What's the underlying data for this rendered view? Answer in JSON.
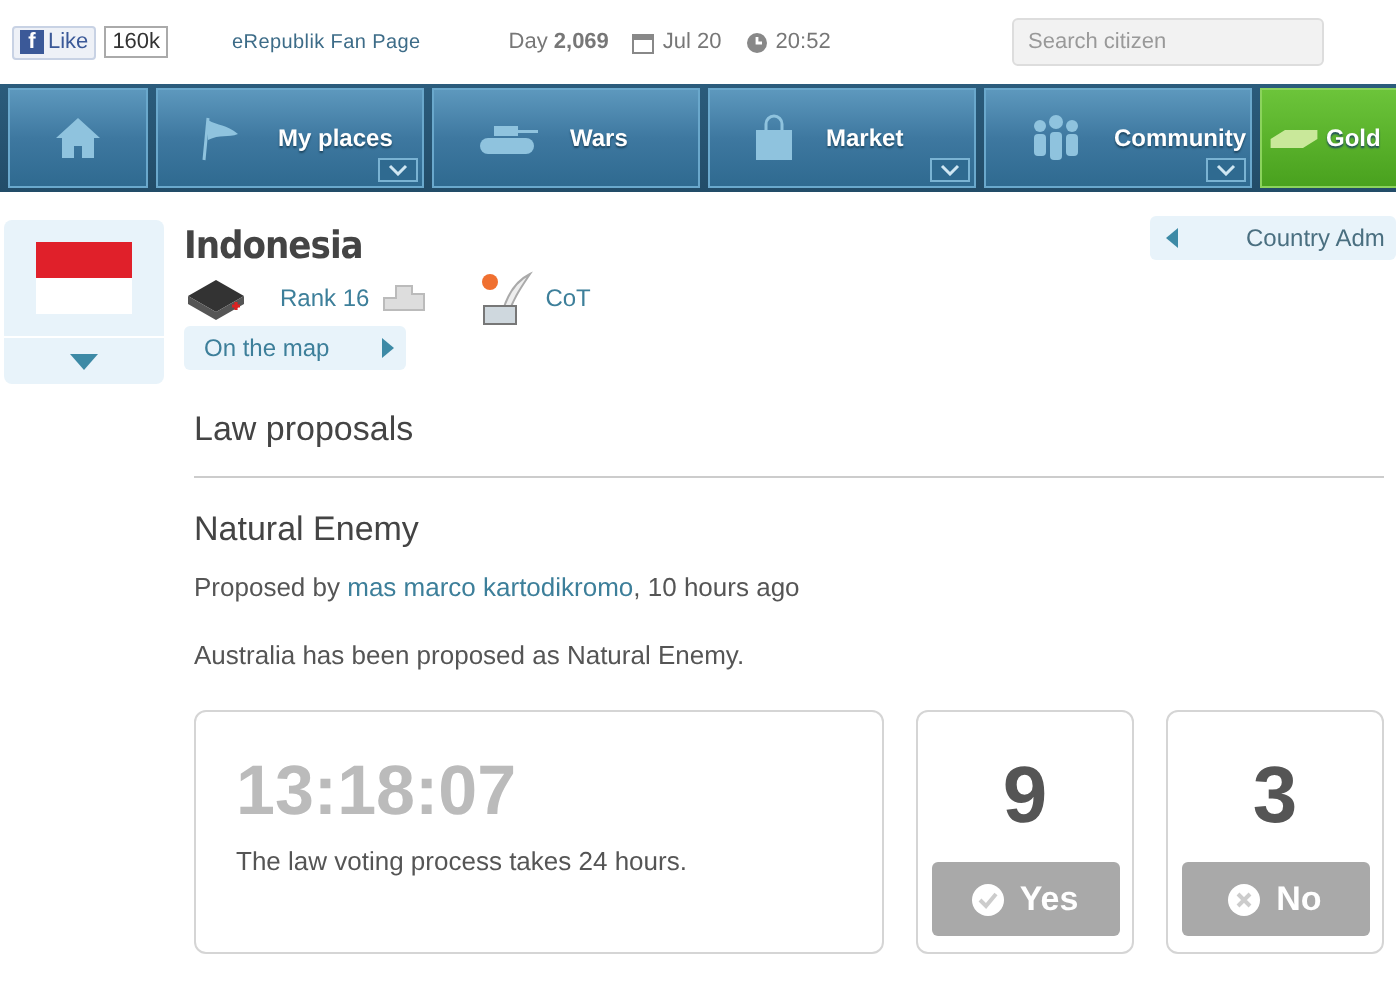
{
  "top_bar": {
    "like_icon": "f",
    "like_button": "Like",
    "like_count": "160k",
    "fan_page_link": "eRepublik Fan Page",
    "day": "Day **2,069**",
    "date": "Jul 20",
    "time": "20:52",
    "search": {
      "placeholder": "Search citizen"
    }
  },
  "nav": [
    {
      "kind": "home",
      "dropdown": false
    },
    {
      "kind": "places",
      "label": "My places",
      "dropdown": true
    },
    {
      "kind": "wars",
      "label": "Wars",
      "dropdown": false
    },
    {
      "kind": "market",
      "label": "Market",
      "dropdown": true
    },
    {
      "kind": "community",
      "label": "Community",
      "dropdown": true
    },
    {
      "kind": "gold",
      "label": "Gold",
      "dropdown": false
    }
  ],
  "country": {
    "name": "Indonesia",
    "rank": "Rank 16",
    "government": "CoT",
    "map_link": "On the map",
    "admin_link": "Country Adm"
  },
  "section_title": "Law proposals",
  "proposal": {
    "title": "Natural Enemy",
    "proposed_prefix": "Proposed by",
    "proposer": "mas marco kartodikromo",
    "proposed_suffix": ", 10 hours ago",
    "description": "Australia has been proposed as Natural Enemy.",
    "countdown": "13:18:07",
    "countdown_note": "The law voting process takes 24 hours.",
    "votes": [
      {
        "kind": "yes",
        "count": "9",
        "label": "Yes",
        "disabled": true
      },
      {
        "kind": "no",
        "count": "3",
        "label": "No",
        "disabled": true
      }
    ]
  }
}
